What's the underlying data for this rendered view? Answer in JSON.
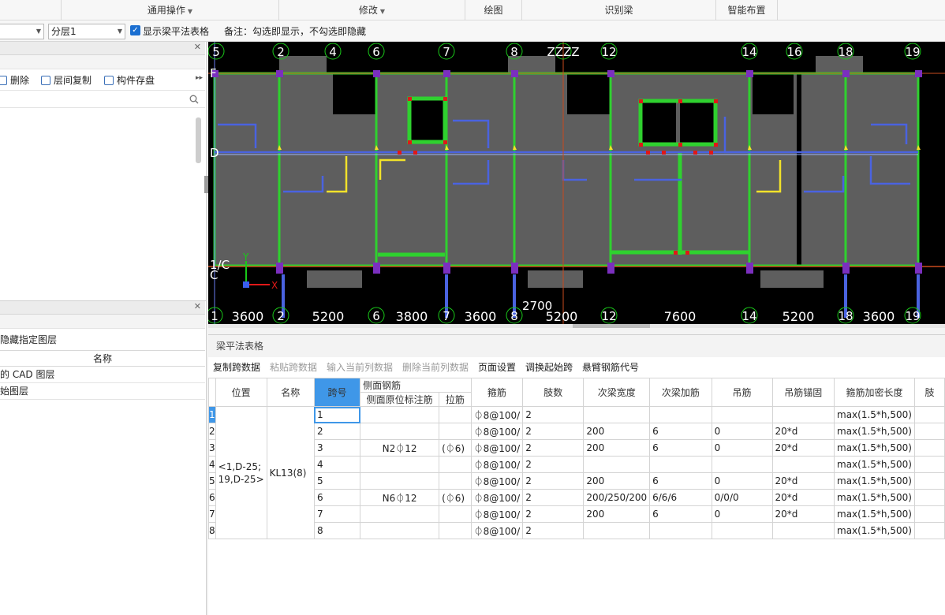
{
  "ribbon": {
    "groups": [
      {
        "label": "通用操作",
        "has_arrow": true
      },
      {
        "label": "修改",
        "has_arrow": true
      },
      {
        "label": "绘图",
        "has_arrow": false
      },
      {
        "label": "识别梁",
        "has_arrow": false
      },
      {
        "label": "智能布置",
        "has_arrow": false
      }
    ]
  },
  "options": {
    "layer_combo_value": "分层1",
    "show_table_checkbox_label": "显示梁平法表格",
    "note": "备注：勾选即显示，不勾选即隐藏"
  },
  "left_top": {
    "tools": [
      {
        "label": "删除"
      },
      {
        "label": "层间复制"
      },
      {
        "label": "构件存盘"
      }
    ]
  },
  "left_bottom": {
    "title": "隐藏指定图层",
    "column_header": "名称",
    "rows": [
      "的 CAD 图层",
      "始图层"
    ]
  },
  "cad": {
    "top_axis_labels": [
      "5",
      "2",
      "4",
      "6",
      "7",
      "8",
      "ZZZZ",
      "12",
      "14",
      "16",
      "18",
      "19"
    ],
    "bottom_axis_labels": [
      "1",
      "2",
      "6",
      "7",
      "8",
      "12",
      "14",
      "18",
      "19"
    ],
    "bottom_dims": [
      "3600",
      "5200",
      "3800",
      "3600",
      "5200",
      "7600",
      "5200",
      "3600"
    ],
    "extra_dim": "2700",
    "left_axis_labels": [
      "F",
      "D",
      "1/C",
      "C"
    ],
    "ucs_x": "X",
    "ucs_y": "Y"
  },
  "beam_table": {
    "title": "梁平法表格",
    "tools": [
      {
        "label": "复制跨数据",
        "enabled": true
      },
      {
        "label": "粘贴跨数据",
        "enabled": false
      },
      {
        "label": "输入当前列数据",
        "enabled": false
      },
      {
        "label": "删除当前列数据",
        "enabled": false
      },
      {
        "label": "页面设置",
        "enabled": true
      },
      {
        "label": "调换起始跨",
        "enabled": true
      },
      {
        "label": "悬臂钢筋代号",
        "enabled": true
      }
    ],
    "headers": {
      "position": "位置",
      "name": "名称",
      "span": "跨号",
      "side_rebar_group": "侧面钢筋",
      "side_rebar": "侧面原位标注筋",
      "tie": "拉筋",
      "stirrup": "箍筋",
      "legs": "肢数",
      "sec_width": "次梁宽度",
      "sec_rebar": "次梁加筋",
      "hanger": "吊筋",
      "hanger_anchor": "吊筋锚固",
      "dense_len": "箍筋加密长度",
      "last": "肢"
    },
    "position_value": "<1,D-25;\n19,D-25>",
    "name_value": "KL13(8)",
    "rows": [
      {
        "rn": "1",
        "span": "1",
        "side": "",
        "tie": "",
        "stirrup": "⏀8@100/",
        "legs": "2",
        "sec_w": "",
        "sec_r": "",
        "hanger": "",
        "anchor": "",
        "dense": "max(1.5*h,500)"
      },
      {
        "rn": "2",
        "span": "2",
        "side": "",
        "tie": "",
        "stirrup": "⏀8@100/",
        "legs": "2",
        "sec_w": "200",
        "sec_r": "6",
        "hanger": "0",
        "anchor": "20*d",
        "dense": "max(1.5*h,500)"
      },
      {
        "rn": "3",
        "span": "3",
        "side": "N2⏀12",
        "tie": "(⏀6)",
        "stirrup": "⏀8@100/",
        "legs": "2",
        "sec_w": "200",
        "sec_r": "6",
        "hanger": "0",
        "anchor": "20*d",
        "dense": "max(1.5*h,500)"
      },
      {
        "rn": "4",
        "span": "4",
        "side": "",
        "tie": "",
        "stirrup": "⏀8@100/",
        "legs": "2",
        "sec_w": "",
        "sec_r": "",
        "hanger": "",
        "anchor": "",
        "dense": "max(1.5*h,500)"
      },
      {
        "rn": "5",
        "span": "5",
        "side": "",
        "tie": "",
        "stirrup": "⏀8@100/",
        "legs": "2",
        "sec_w": "200",
        "sec_r": "6",
        "hanger": "0",
        "anchor": "20*d",
        "dense": "max(1.5*h,500)"
      },
      {
        "rn": "6",
        "span": "6",
        "side": "N6⏀12",
        "tie": "(⏀6)",
        "stirrup": "⏀8@100/",
        "legs": "2",
        "sec_w": "200/250/200",
        "sec_r": "6/6/6",
        "hanger": "0/0/0",
        "anchor": "20*d",
        "dense": "max(1.5*h,500)"
      },
      {
        "rn": "7",
        "span": "7",
        "side": "",
        "tie": "",
        "stirrup": "⏀8@100/",
        "legs": "2",
        "sec_w": "200",
        "sec_r": "6",
        "hanger": "0",
        "anchor": "20*d",
        "dense": "max(1.5*h,500)"
      },
      {
        "rn": "8",
        "span": "8",
        "side": "",
        "tie": "",
        "stirrup": "⏀8@100/",
        "legs": "2",
        "sec_w": "",
        "sec_r": "",
        "hanger": "",
        "anchor": "",
        "dense": "max(1.5*h,500)"
      }
    ]
  },
  "colors": {
    "cad_background": "#000000",
    "slab_fill": "#5e5e5e",
    "beam_green": "#2fd12f",
    "axis_blue": "#4a63e0",
    "yellow": "#f2e22a",
    "column_purple": "#7b2fbf",
    "accent_blue": "#3f97e8"
  }
}
